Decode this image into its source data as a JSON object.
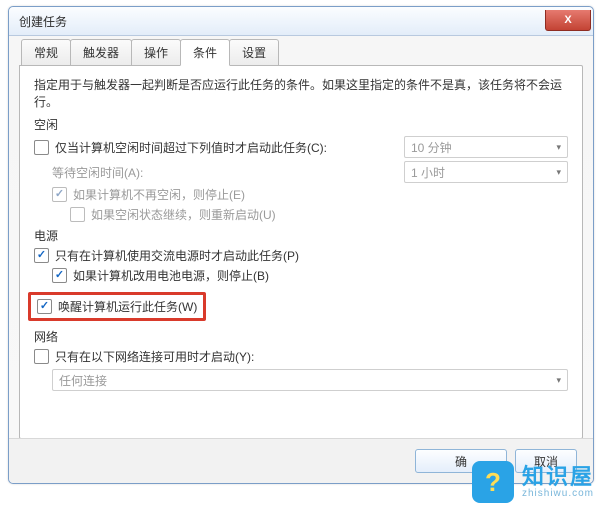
{
  "window": {
    "title": "创建任务",
    "close": "X"
  },
  "tabs": {
    "t0": "常规",
    "t1": "触发器",
    "t2": "操作",
    "t3": "条件",
    "t4": "设置"
  },
  "desc": "指定用于与触发器一起判断是否应运行此任务的条件。如果这里指定的条件不是真，该任务将不会运行。",
  "idle": {
    "header": "空闲",
    "only_if_idle": "仅当计算机空闲时间超过下列值时才启动此任务(C):",
    "idle_value": "10 分钟",
    "wait_label": "等待空闲时间(A):",
    "wait_value": "1 小时",
    "stop_if_not_idle": "如果计算机不再空闲，则停止(E)",
    "restart_on_idle": "如果空闲状态继续，则重新启动(U)"
  },
  "power": {
    "header": "电源",
    "ac_only": "只有在计算机使用交流电源时才启动此任务(P)",
    "stop_on_battery": "如果计算机改用电池电源，则停止(B)",
    "wake": "唤醒计算机运行此任务(W)"
  },
  "network": {
    "header": "网络",
    "only_if_net": "只有在以下网络连接可用时才启动(Y):",
    "any": "任何连接"
  },
  "footer": {
    "ok": "确",
    "cancel": "取消"
  },
  "watermark": {
    "big": "知识屋",
    "small": "zhishiwu.com"
  }
}
